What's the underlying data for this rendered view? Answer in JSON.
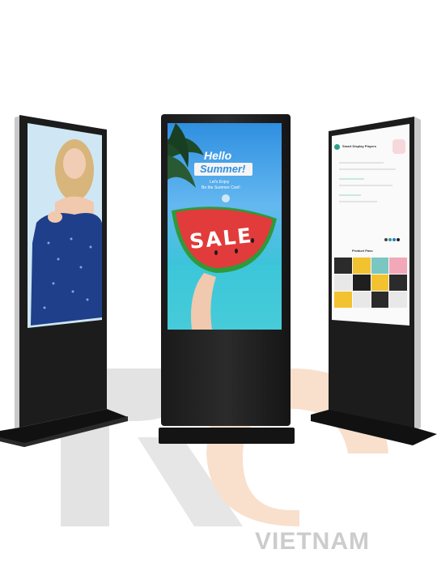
{
  "watermark": {
    "brand_text": "VIETNAM"
  },
  "center_kiosk": {
    "hello_line": "Hello",
    "summer_line": "Summer!",
    "sub_line_1": "Let's Enjoy",
    "sub_line_2": "Be the Summer Cool!",
    "sale_text": "SALE"
  },
  "right_kiosk": {
    "header_title": "Smart Display Players",
    "product_section_title": "Product Pass"
  },
  "colors": {
    "screen_bezel": "#111111",
    "stand_body": "#1f1f1f",
    "sky_blue": "#3aa0e8",
    "sea_teal": "#33c4d6",
    "watermelon_red": "#e23b3b",
    "dress_navy": "#1f3f8a",
    "watermark_gray": "#d9d9d9",
    "watermark_orange": "#f7dcc6"
  }
}
